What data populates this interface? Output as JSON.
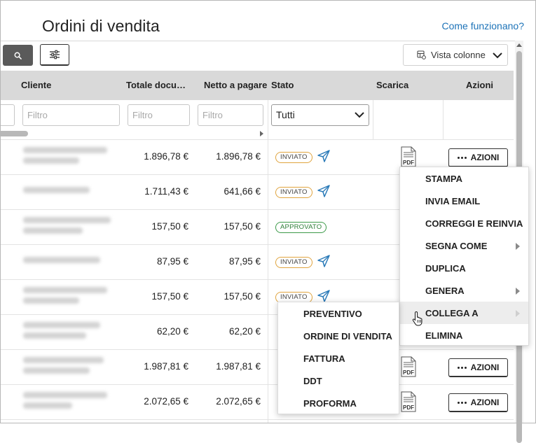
{
  "header": {
    "title": "Ordini di vendita",
    "help_link": "Come funzionano?"
  },
  "toolbar": {
    "search_icon": "search-icon",
    "filter_icon": "sliders-icon",
    "columns_label": "Vista colonne"
  },
  "table": {
    "columns": [
      "Cliente",
      "Totale docu…",
      "Netto a pagare",
      "Stato",
      "Scarica",
      "Azioni"
    ],
    "filters": {
      "placeholder": "Filtro",
      "status_selected": "Tutti"
    },
    "rows": [
      {
        "totale": "1.896,78 €",
        "netto": "1.896,78 €",
        "stato": "INVIATO",
        "sent": true
      },
      {
        "totale": "1.711,43 €",
        "netto": "641,66 €",
        "stato": "INVIATO",
        "sent": true
      },
      {
        "totale": "157,50 €",
        "netto": "157,50 €",
        "stato": "APPROVATO",
        "sent": false
      },
      {
        "totale": "87,95 €",
        "netto": "87,95 €",
        "stato": "INVIATO",
        "sent": true
      },
      {
        "totale": "157,50 €",
        "netto": "157,50 €",
        "stato": "INVIATO",
        "sent": true
      },
      {
        "totale": "62,20 €",
        "netto": "62,20 €",
        "stato": "",
        "sent": false
      },
      {
        "totale": "1.987,81 €",
        "netto": "1.987,81 €",
        "stato": "",
        "sent": false
      },
      {
        "totale": "2.072,65 €",
        "netto": "2.072,65 €",
        "stato": "",
        "sent": false
      }
    ],
    "pdf_label": "PDF",
    "actions_label": "AZIONI"
  },
  "actions_menu": {
    "items": [
      "STAMPA",
      "INVIA EMAIL",
      "CORREGGI E REINVIA",
      "SEGNA COME",
      "DUPLICA",
      "GENERA",
      "COLLEGA A",
      "ELIMINA"
    ]
  },
  "link_submenu": {
    "items": [
      "PREVENTIVO",
      "ORDINE DI VENDITA",
      "FATTURA",
      "DDT",
      "PROFORMA"
    ]
  },
  "colors": {
    "link": "#1d73b8",
    "sent_badge": "#e0a43e",
    "approved_badge": "#3c9a49",
    "plane_icon": "#2a7ab8"
  }
}
